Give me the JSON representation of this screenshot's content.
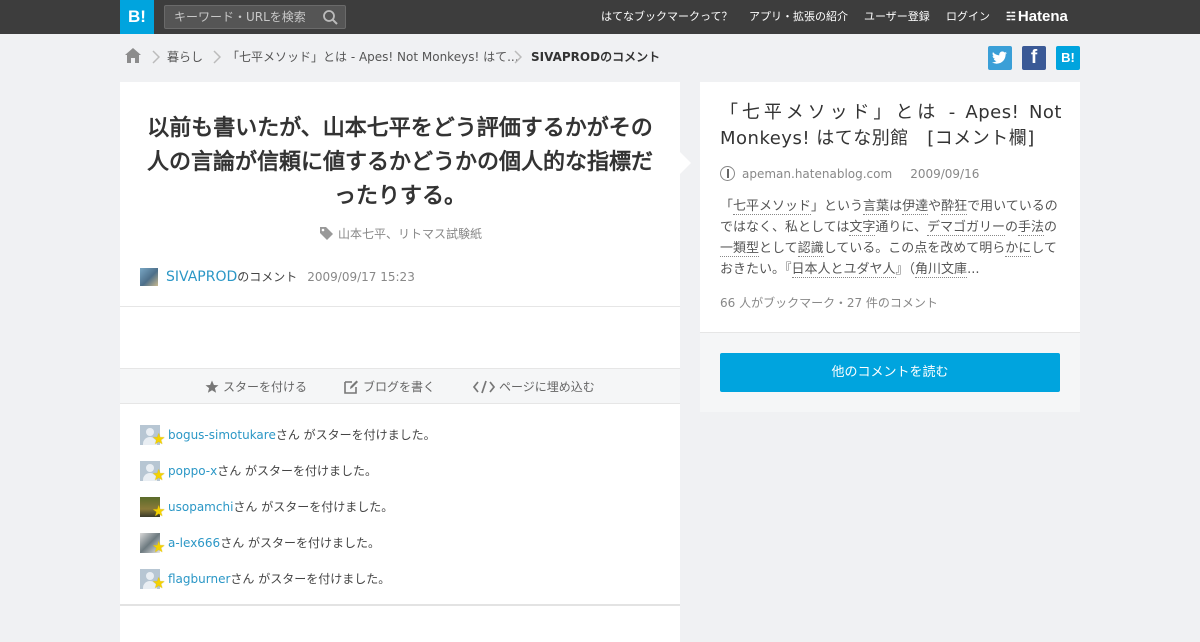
{
  "header": {
    "logo": "B!",
    "search_placeholder": "キーワード・URLを検索",
    "nav": [
      "はてなブックマークって？",
      "アプリ・拡張の紹介",
      "ユーザー登録",
      "ログイン"
    ],
    "brand": "Hatena",
    "bg_color": "#3d3d3d",
    "accent_color": "#00a4de"
  },
  "breadcrumb": {
    "items": [
      "暮らし",
      "「七平メソッド」とは - Apes! Not Monkeys! はて...",
      "SIVAPRODのコメント"
    ]
  },
  "share": {
    "twitter_color": "#3a9fd7",
    "facebook_color": "#3a5996",
    "hatena_label": "B!"
  },
  "comment": {
    "headline": "以前も書いたが、山本七平をどう評価するかがその人の言論が信頼に値するかどうかの個人的な指標だったりする。",
    "tags": "山本七平、リトマス試験紙",
    "user": "SIVAPROD",
    "user_suffix": "のコメント",
    "date": "2009/09/17 15:23"
  },
  "actions": {
    "star": "スターを付ける",
    "blog": "ブログを書く",
    "embed": "ページに埋め込む"
  },
  "stars": {
    "suffix": "さん がスターを付けました。",
    "users": [
      "bogus-simotukare",
      "poppo-x",
      "usopamchi",
      "a-lex666",
      "flagburner"
    ]
  },
  "entry": {
    "title": "「七平メソッド」とは - Apes! Not Monkeys! はてな別館　[コメント欄]",
    "domain": "apeman.hatenablog.com",
    "date": "2009/09/16",
    "summary_parts": [
      {
        "t": "「",
        "kw": false
      },
      {
        "t": "七平メソッド",
        "kw": true
      },
      {
        "t": "」という",
        "kw": false
      },
      {
        "t": "言葉",
        "kw": true
      },
      {
        "t": "は",
        "kw": false
      },
      {
        "t": "伊達",
        "kw": true
      },
      {
        "t": "や",
        "kw": false
      },
      {
        "t": "酔狂",
        "kw": true
      },
      {
        "t": "で用いているのではなく、私としては",
        "kw": false
      },
      {
        "t": "文字",
        "kw": true
      },
      {
        "t": "通りに、",
        "kw": false
      },
      {
        "t": "デマゴガリー",
        "kw": true
      },
      {
        "t": "の",
        "kw": false
      },
      {
        "t": "手法",
        "kw": true
      },
      {
        "t": "の",
        "kw": false
      },
      {
        "t": "一類型",
        "kw": true
      },
      {
        "t": "として",
        "kw": false
      },
      {
        "t": "認識",
        "kw": true
      },
      {
        "t": "している。この点を改めて明ら",
        "kw": false
      },
      {
        "t": "かに",
        "kw": true
      },
      {
        "t": "しておきたい。『",
        "kw": false
      },
      {
        "t": "日本人とユダヤ人",
        "kw": true
      },
      {
        "t": "』（",
        "kw": false
      },
      {
        "t": "角川文庫",
        "kw": true
      },
      {
        "t": "...",
        "kw": false
      }
    ],
    "counts": "66 人がブックマーク・27 件のコメント",
    "read_more": "他のコメントを読む"
  }
}
